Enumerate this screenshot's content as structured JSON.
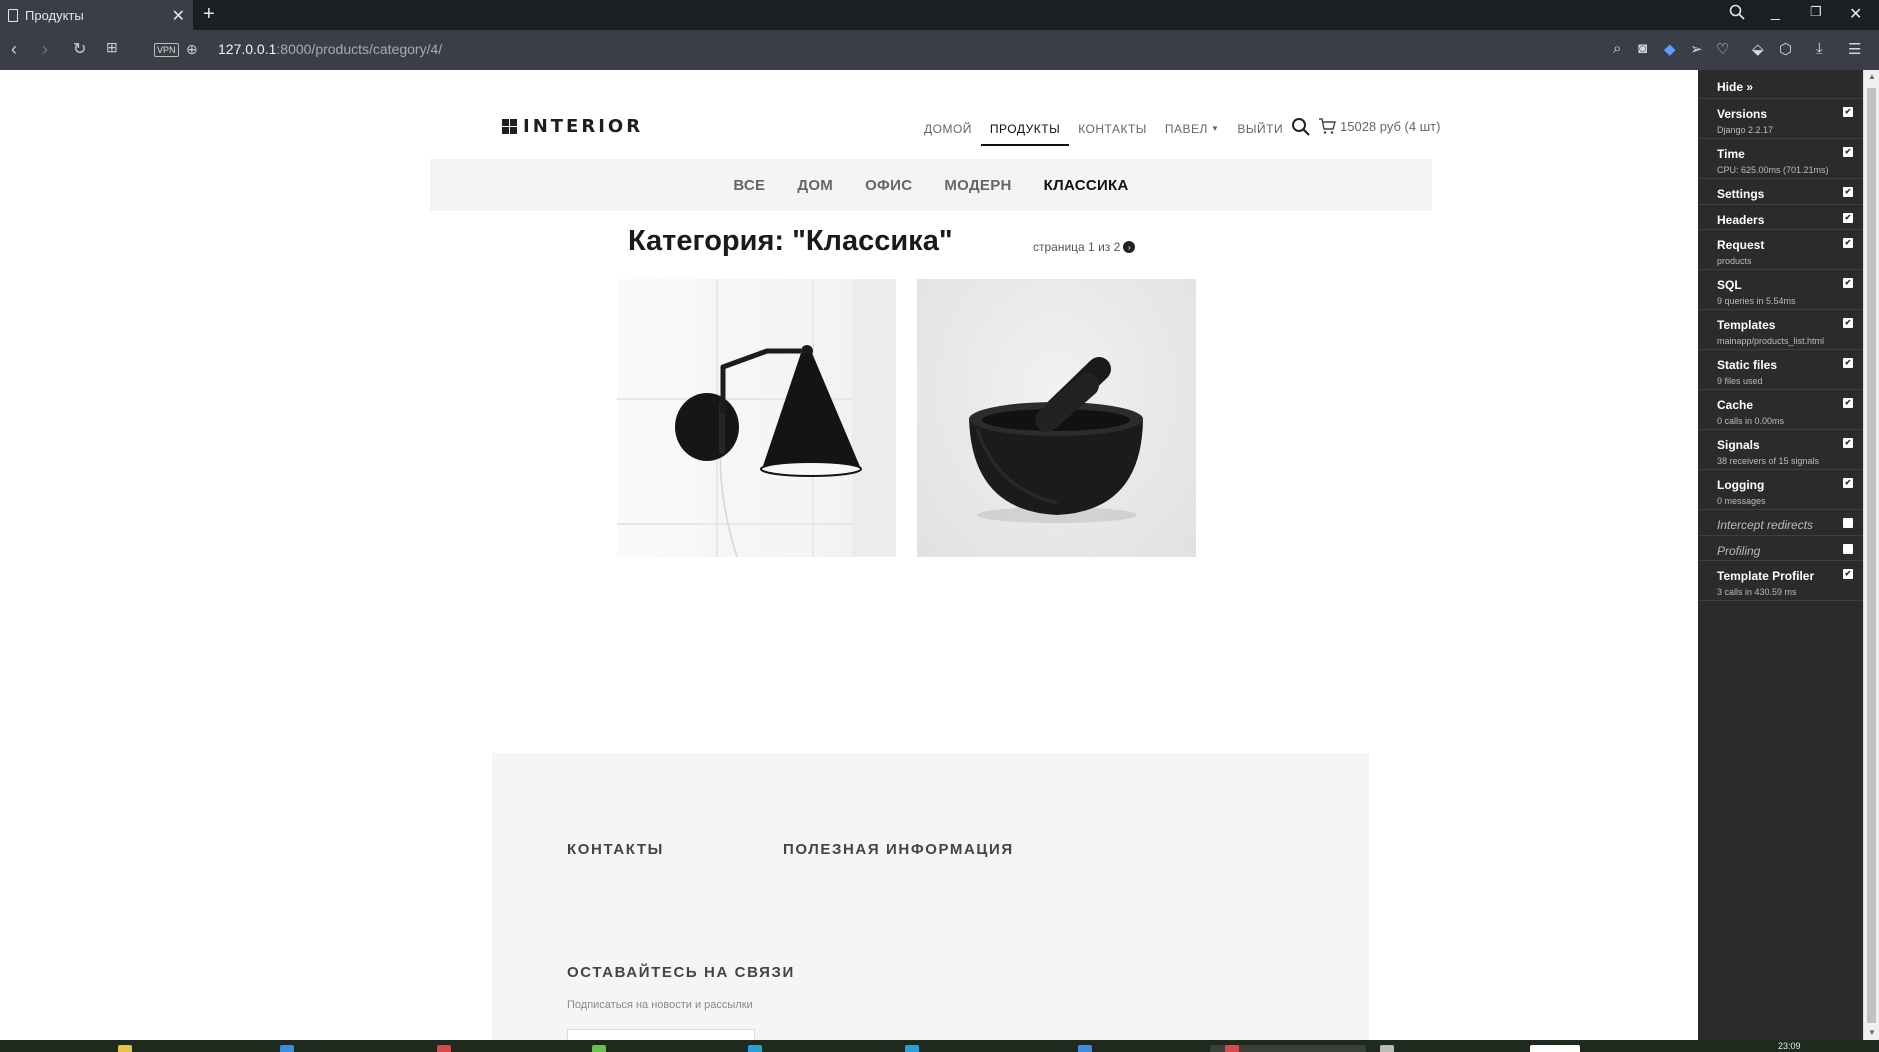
{
  "browser": {
    "tab_title": "Продукты",
    "url_host": "127.0.0.1",
    "url_path": ":8000/products/category/4/",
    "vpn_label": "VPN"
  },
  "site": {
    "logo": "INTERIOR",
    "nav": [
      {
        "label": "ДОМОЙ",
        "active": false
      },
      {
        "label": "ПРОДУКТЫ",
        "active": true
      },
      {
        "label": "КОНТАКТЫ",
        "active": false
      },
      {
        "label": "ПАВЕЛ",
        "active": false,
        "dropdown": true
      },
      {
        "label": "ВЫЙТИ",
        "active": false
      }
    ],
    "cart_text": "15028 руб (4 шт)"
  },
  "categories": [
    {
      "label": "ВСЕ",
      "active": false
    },
    {
      "label": "ДОМ",
      "active": false
    },
    {
      "label": "ОФИС",
      "active": false
    },
    {
      "label": "МОДЕРН",
      "active": false
    },
    {
      "label": "КЛАССИКА",
      "active": true
    }
  ],
  "main": {
    "title": "Категория: \"Классика\"",
    "pager_text": "страница 1 из 2"
  },
  "products": [
    {
      "name": "wall-lamp"
    },
    {
      "name": "mortar-and-pestle"
    }
  ],
  "footer": {
    "contacts": "КОНТАКТЫ",
    "info": "ПОЛЕЗНАЯ ИНФОРМАЦИЯ",
    "stay": "ОСТАВАЙТЕСЬ НА СВЯЗИ",
    "subscribe": "Подписаться на новости и рассылки"
  },
  "debug_toolbar": {
    "hide": "Hide »",
    "panels": [
      {
        "title": "Versions",
        "sub": "Django 2.2.17",
        "checked": true
      },
      {
        "title": "Time",
        "sub": "CPU: 625.00ms (701.21ms)",
        "checked": true
      },
      {
        "title": "Settings",
        "sub": "",
        "checked": true
      },
      {
        "title": "Headers",
        "sub": "",
        "checked": true
      },
      {
        "title": "Request",
        "sub": "products",
        "checked": true
      },
      {
        "title": "SQL",
        "sub": "9 queries in 5.54ms",
        "checked": true
      },
      {
        "title": "Templates",
        "sub": "mainapp/products_list.html",
        "checked": true
      },
      {
        "title": "Static files",
        "sub": "9 files used",
        "checked": true
      },
      {
        "title": "Cache",
        "sub": "0 calls in 0.00ms",
        "checked": true
      },
      {
        "title": "Signals",
        "sub": "38 receivers of 15 signals",
        "checked": true
      },
      {
        "title": "Logging",
        "sub": "0 messages",
        "checked": true
      },
      {
        "title": "Intercept redirects",
        "sub": "",
        "checked": false,
        "italic": true
      },
      {
        "title": "Profiling",
        "sub": "",
        "checked": false,
        "italic": true
      },
      {
        "title": "Template Profiler",
        "sub": "3 calls in 430.59 ms",
        "checked": true
      }
    ]
  },
  "taskbar": {
    "time": "23:09"
  },
  "colors": {
    "accent": "#111111",
    "panel": "#2b2b2b",
    "chrome": "#3a3f47"
  }
}
